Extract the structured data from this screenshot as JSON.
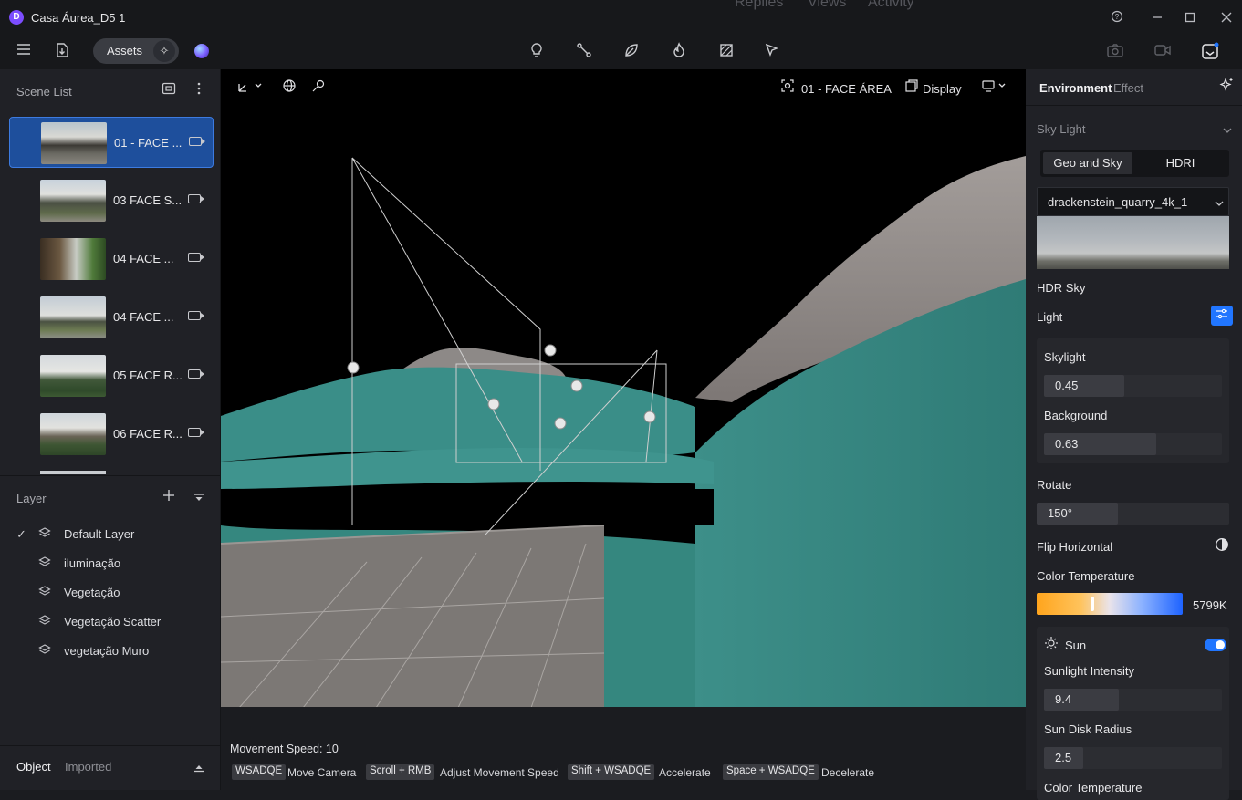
{
  "window": {
    "title": "Casa Áurea_D5 1",
    "logo_letter": "D",
    "ghost_menu": [
      "Replies",
      "Views",
      "Activity"
    ]
  },
  "toolbar": {
    "assets_label": "Assets"
  },
  "scene_list": {
    "title": "Scene List",
    "items": [
      {
        "label": "01 - FACE ...",
        "active": true
      },
      {
        "label": "03 FACE S...",
        "active": false
      },
      {
        "label": "04 FACE ...",
        "active": false
      },
      {
        "label": "04 FACE ...",
        "active": false
      },
      {
        "label": "05 FACE R...",
        "active": false
      },
      {
        "label": "06 FACE R...",
        "active": false
      }
    ]
  },
  "layers": {
    "title": "Layer",
    "items": [
      {
        "label": "Default Layer",
        "checked": true
      },
      {
        "label": "iluminação",
        "checked": false
      },
      {
        "label": "Vegetação",
        "checked": false
      },
      {
        "label": "Vegetação Scatter",
        "checked": false
      },
      {
        "label": "vegetação Muro",
        "checked": false
      }
    ]
  },
  "bottom_tabs": {
    "object": "Object",
    "imported": "Imported"
  },
  "viewport": {
    "camera_name": "01 - FACE ÁREA",
    "display_label": "Display",
    "movement_speed": "Movement Speed: 10",
    "shortcuts": [
      {
        "key": "WSADQE",
        "desc": "Move Camera"
      },
      {
        "key": "Scroll + RMB",
        "desc": "Adjust Movement Speed"
      },
      {
        "key": "Shift + WSADQE",
        "desc": "Accelerate"
      },
      {
        "key": "Space + WSADQE",
        "desc": "Decelerate"
      }
    ]
  },
  "right_panel": {
    "tab_environment": "Environment",
    "tab_effect": "Effect",
    "sky_light": "Sky Light",
    "seg_geo": "Geo and Sky",
    "seg_hdri": "HDRI",
    "hdri_name": "drackenstein_quarry_4k_1",
    "hdr_sky": "HDR Sky",
    "light": "Light",
    "skylight_label": "Skylight",
    "skylight_value": "0.45",
    "skylight_fraction": 0.45,
    "background_label": "Background",
    "background_value": "0.63",
    "background_fraction": 0.63,
    "rotate_label": "Rotate",
    "rotate_value": "150°",
    "rotate_fraction": 0.42,
    "flip_label": "Flip Horizontal",
    "color_temp_label": "Color Temperature",
    "color_temp_value": "5799K",
    "color_temp_fraction": 0.38,
    "sun_label": "Sun",
    "sun_enabled": true,
    "sun_intensity_label": "Sunlight Intensity",
    "sun_intensity_value": "9.4",
    "sun_intensity_fraction": 0.42,
    "sun_disk_label": "Sun Disk Radius",
    "sun_disk_value": "2.5",
    "sun_disk_fraction": 0.22,
    "sun_color_temp_label": "Color Temperature"
  },
  "colors": {
    "accent": "#2176ff",
    "selected": "#1e4f9c",
    "teal": "#3a8f8a",
    "grey_veg": "#8f8a88"
  }
}
